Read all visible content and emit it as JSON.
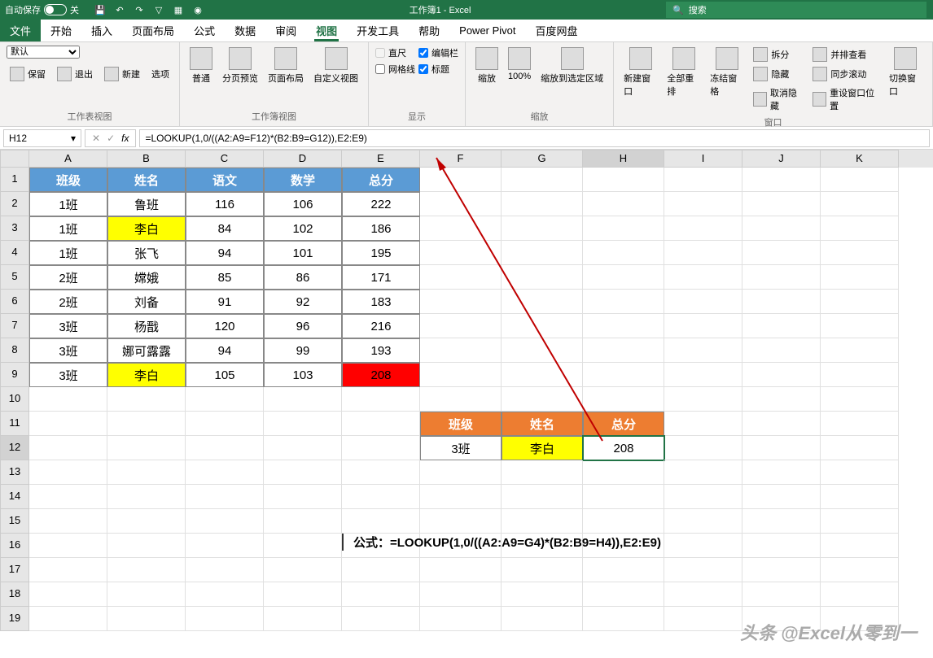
{
  "titlebar": {
    "autosave_label": "自动保存",
    "autosave_state": "关",
    "title": "工作簿1 - Excel",
    "search_placeholder": "搜索"
  },
  "ribbon": {
    "tabs": [
      "文件",
      "开始",
      "插入",
      "页面布局",
      "公式",
      "数据",
      "审阅",
      "视图",
      "开发工具",
      "帮助",
      "Power Pivot",
      "百度网盘"
    ],
    "active_tab": "视图",
    "group1": {
      "label": "工作表视图",
      "default": "默认",
      "keep": "保留",
      "exit": "退出",
      "new": "新建",
      "options": "选项"
    },
    "group2": {
      "label": "工作簿视图",
      "normal": "普通",
      "pagebreak": "分页预览",
      "layout": "页面布局",
      "custom": "自定义视图"
    },
    "group3": {
      "label": "显示",
      "ruler": "直尺",
      "formula_bar": "编辑栏",
      "gridlines": "网格线",
      "headings": "标题"
    },
    "group4": {
      "label": "缩放",
      "zoom": "缩放",
      "hundred": "100%",
      "zoom_selection": "缩放到选定区域"
    },
    "group5": {
      "label": "窗口",
      "new_window": "新建窗口",
      "arrange": "全部重排",
      "freeze": "冻结窗格",
      "split": "拆分",
      "hide": "隐藏",
      "unhide": "取消隐藏",
      "side": "并排查看",
      "sync": "同步滚动",
      "reset": "重设窗口位置",
      "switch": "切换窗口"
    }
  },
  "formula_bar": {
    "name_box": "H12",
    "formula": "=LOOKUP(1,0/((A2:A9=F12)*(B2:B9=G12)),E2:E9)"
  },
  "columns": [
    "A",
    "B",
    "C",
    "D",
    "E",
    "F",
    "G",
    "H",
    "I",
    "J",
    "K"
  ],
  "table1": {
    "headers": [
      "班级",
      "姓名",
      "语文",
      "数学",
      "总分"
    ],
    "rows": [
      [
        "1班",
        "鲁班",
        "116",
        "106",
        "222"
      ],
      [
        "1班",
        "李白",
        "84",
        "102",
        "186"
      ],
      [
        "1班",
        "张飞",
        "94",
        "101",
        "195"
      ],
      [
        "2班",
        "嫦娥",
        "85",
        "86",
        "171"
      ],
      [
        "2班",
        "刘备",
        "91",
        "92",
        "183"
      ],
      [
        "3班",
        "杨戬",
        "120",
        "96",
        "216"
      ],
      [
        "3班",
        "娜可露露",
        "94",
        "99",
        "193"
      ],
      [
        "3班",
        "李白",
        "105",
        "103",
        "208"
      ]
    ]
  },
  "table2": {
    "headers": [
      "班级",
      "姓名",
      "总分"
    ],
    "row": [
      "3班",
      "李白",
      "208"
    ]
  },
  "formula_note": "公式：=LOOKUP(1,0/((A2:A9=G4)*(B2:B9=H4)),E2:E9)",
  "watermark": "头条 @Excel从零到一"
}
